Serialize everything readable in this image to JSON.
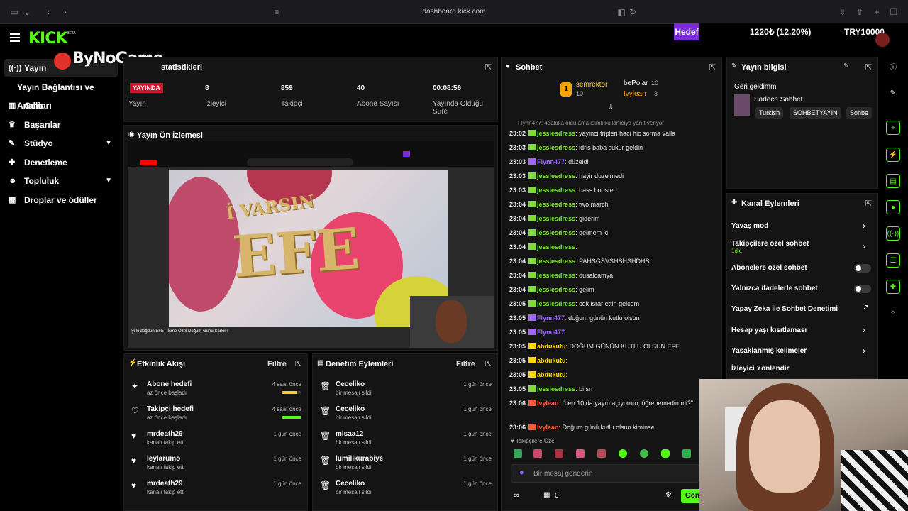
{
  "browser": {
    "url": "dashboard.kick.com"
  },
  "header": {
    "logo": "KICK",
    "beta": "BETA",
    "watermark": "ByNoGame",
    "goal_label": "Hedef",
    "goal_value": "1220₺ (12.20%)",
    "goal_target": "TRY10000"
  },
  "sidebar": {
    "items": [
      {
        "label": "Yayın",
        "icon": "stream-icon"
      },
      {
        "label": "Yayın Bağlantısı ve Anahtarı",
        "icon": ""
      },
      {
        "label": "Gelir",
        "icon": "chart-icon"
      },
      {
        "label": "Başarılar",
        "icon": "trophy-icon"
      },
      {
        "label": "Stüdyo",
        "icon": "brush-icon"
      },
      {
        "label": "Denetleme",
        "icon": "wrench-icon"
      },
      {
        "label": "Topluluk",
        "icon": "people-icon"
      },
      {
        "label": "Droplar ve ödüller",
        "icon": "gift-icon"
      }
    ]
  },
  "stats": {
    "title": "statistikleri",
    "live_badge": "YAYINDA",
    "stream_label": "Yayın",
    "viewers_value": "8",
    "viewers_label": "İzleyici",
    "followers_value": "859",
    "followers_label": "Takipçi",
    "subs_value": "40",
    "subs_label": "Abone Sayısı",
    "uptime_value": "00:08:56",
    "uptime_label": "Yayında Olduğu Süre"
  },
  "preview": {
    "title": "Yayın Ön İzlemesi",
    "video_title": "İyi ki doğdun EFE - İsme Özel Doğum Günü Şarkısı",
    "scene_top": "İ VARSIN",
    "scene_main": "EFE"
  },
  "activity": {
    "title": "Etkinlik Akışı",
    "filter": "Filtre",
    "rows": [
      {
        "title": "Abone hedefi",
        "sub": "az önce başladı",
        "time": "4 saat önce",
        "icon": "sparkle-icon",
        "progress": 0.8,
        "color": "#f6c944"
      },
      {
        "title": "Takipçi hedefi",
        "sub": "az önce başladı",
        "time": "4 saat önce",
        "icon": "heart-outline-icon",
        "progress": 0.95,
        "color": "#53fc18"
      },
      {
        "title": "mrdeath29",
        "sub": "kanalı takip etti",
        "time": "1 gün önce",
        "icon": "heart-icon"
      },
      {
        "title": "leylarumo",
        "sub": "kanalı takip etti",
        "time": "1 gün önce",
        "icon": "heart-icon"
      },
      {
        "title": "mrdeath29",
        "sub": "kanalı takip etti",
        "time": "1 gün önce",
        "icon": "heart-icon"
      }
    ]
  },
  "moderation": {
    "title": "Denetim Eylemleri",
    "filter": "Filtre",
    "rows": [
      {
        "title": "Ceceliko",
        "sub": "bir mesajı sildi",
        "time": "1 gün önce"
      },
      {
        "title": "Ceceliko",
        "sub": "bir mesajı sildi",
        "time": "1 gün önce"
      },
      {
        "title": "mlsaa12",
        "sub": "bir mesajı sildi",
        "time": "1 gün önce"
      },
      {
        "title": "lumilikurabiye",
        "sub": "bir mesajı sildi",
        "time": "1 gün önce"
      },
      {
        "title": "Ceceliko",
        "sub": "bir mesajı sildi",
        "time": "1 gün önce"
      }
    ]
  },
  "chat": {
    "title": "Sohbet",
    "top1_name": "semrektor",
    "top1_count": "10",
    "top2_name": "bePolar",
    "top2_count": "10",
    "top3_name": "Ivylean",
    "top3_count": "3",
    "notice": "Flynn477: 4dakika oldu ama isimli kullanıcıya yanıt veriyor",
    "messages": [
      {
        "time": "23:02",
        "user": "jessiesdress",
        "text": "yayinci tripleri haci hic sorma valla",
        "color": "#7bdc3a"
      },
      {
        "time": "23:03",
        "user": "jessiesdress",
        "text": "idris baba sukur geldin",
        "color": "#7bdc3a"
      },
      {
        "time": "23:03",
        "user": "Flynn477",
        "text": "düzeldi",
        "color": "#a066ff"
      },
      {
        "time": "23:03",
        "user": "jessiesdress",
        "text": "hayir duzelmedi",
        "color": "#7bdc3a"
      },
      {
        "time": "23:03",
        "user": "jessiesdress",
        "text": "bass boosted",
        "color": "#7bdc3a"
      },
      {
        "time": "23:04",
        "user": "jessiesdress",
        "text": "two march",
        "color": "#7bdc3a"
      },
      {
        "time": "23:04",
        "user": "jessiesdress",
        "text": "giderim",
        "color": "#7bdc3a"
      },
      {
        "time": "23:04",
        "user": "jessiesdress",
        "text": "gelmem ki",
        "color": "#7bdc3a"
      },
      {
        "time": "23:04",
        "user": "jessiesdress",
        "text": "",
        "color": "#7bdc3a"
      },
      {
        "time": "23:04",
        "user": "jessiesdress",
        "text": "PAHSGSVSHSHSHDHS",
        "color": "#7bdc3a"
      },
      {
        "time": "23:04",
        "user": "jessiesdress",
        "text": "dusalcamya",
        "color": "#7bdc3a"
      },
      {
        "time": "23:04",
        "user": "jessiesdress",
        "text": "gelim",
        "color": "#7bdc3a"
      },
      {
        "time": "23:05",
        "user": "jessiesdress",
        "text": "cok israr ettin gelcem",
        "color": "#7bdc3a"
      },
      {
        "time": "23:05",
        "user": "Flynn477",
        "text": "doğum günün kutlu olsun",
        "color": "#a066ff"
      },
      {
        "time": "23:05",
        "user": "Flynn477",
        "text": "",
        "color": "#a066ff"
      },
      {
        "time": "23:05",
        "user": "abdukutu",
        "text": "DOĞUM GÜNÜN KUTLU OLSUN EFE",
        "color": "#ffd400"
      },
      {
        "time": "23:05",
        "user": "abdukutu",
        "text": "",
        "color": "#ffd400"
      },
      {
        "time": "23:05",
        "user": "abdukutu",
        "text": "",
        "color": "#ffd400"
      },
      {
        "time": "23:05",
        "user": "jessiesdress",
        "text": "bi sn",
        "color": "#7bdc3a"
      },
      {
        "time": "23:06",
        "user": "Ivylean",
        "text": "\"ben 10 da yayın açıyorum, öğrenemedin mi?\"",
        "color": "#ff5a36"
      },
      {
        "time": "23:06",
        "user": "Ivylean",
        "text": "Doğum günü kutlu olsun kiminse",
        "color": "#ff5a36"
      }
    ],
    "followers_only": "Takipçilere Özel",
    "input_placeholder": "Bir mesaj gönderin",
    "points": "0",
    "send": "Gönder"
  },
  "stream_info": {
    "title": "Yayın bilgisi",
    "stream_title": "Geri geldimm",
    "category": "Sadece Sohbet",
    "tags": [
      "Turkish",
      "SOHBETYAYIN",
      "Sohbe"
    ]
  },
  "channel_actions": {
    "title": "Kanal Eylemleri",
    "slow_mode": "Yavaş mod",
    "followers_chat": "Takipçilere özel sohbet",
    "followers_chat_sub": "1dk.",
    "subs_chat": "Abonelere özel sohbet",
    "emote_chat": "Yalnızca ifadelerle sohbet",
    "ai_mod": "Yapay Zeka ile Sohbet Denetimi",
    "age_limit": "Hesap yaşı kısıtlaması",
    "banned_words": "Yasaklanmış kelimeler",
    "redirect": "İzleyici Yönlendir"
  }
}
